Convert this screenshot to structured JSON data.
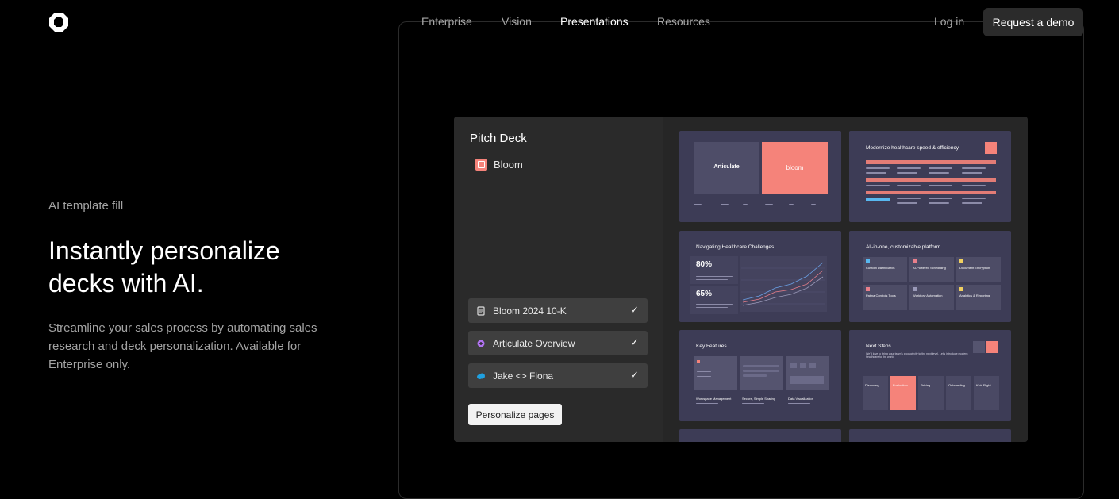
{
  "nav": {
    "items": [
      {
        "label": "Enterprise",
        "active": false
      },
      {
        "label": "Vision",
        "active": false
      },
      {
        "label": "Presentations",
        "active": true
      },
      {
        "label": "Resources",
        "active": false
      }
    ],
    "login_label": "Log in",
    "demo_label": "Request a demo"
  },
  "hero": {
    "eyebrow": "AI template fill",
    "headline_line1": "Instantly personalize",
    "headline_line2": "decks with AI.",
    "description": "Streamline your sales process by automating sales research and deck personalization. Available for Enterprise only."
  },
  "panel": {
    "title": "Pitch Deck",
    "company": "Bloom",
    "sources": [
      {
        "label": "Bloom 2024 10-K",
        "icon": "document-icon"
      },
      {
        "label": "Articulate Overview",
        "icon": "articulate-icon"
      },
      {
        "label": "Jake <> Fiona",
        "icon": "salesforce-cloud-icon"
      }
    ],
    "check_icon": "✓",
    "personalize_label": "Personalize pages"
  },
  "slides": {
    "s1": {
      "left_brand": "Articulate",
      "right_brand": "bloom"
    },
    "s2": {
      "title": "Modernize healthcare speed & efficiency."
    },
    "s3": {
      "title": "Navigating Healthcare Challenges",
      "stat1": "80%",
      "stat2": "65%"
    },
    "s4": {
      "title": "All-in-one, customizable platform.",
      "features": [
        "Custom Dashboards",
        "AI-Powered Scheduling",
        "Document Encryption",
        "Patina Controls Tools",
        "Workflow Automation",
        "Analytics & Reporting"
      ]
    },
    "s5": {
      "title": "Key Features",
      "cols": [
        "Workspace Management",
        "Secure, Simple Sharing",
        "Data Visualization"
      ]
    },
    "s6": {
      "title": "Next Steps",
      "subtitle": "We'd love to bring your team's productivity to the next level. Let's introduce modern healthcare to the world.",
      "steps": [
        "Discovery",
        "Evaluation",
        "Pricing",
        "Onboarding",
        "Kick-Flight"
      ]
    }
  },
  "colors": {
    "accent": "#f5837a",
    "slide_bg": "#3d3c56"
  }
}
